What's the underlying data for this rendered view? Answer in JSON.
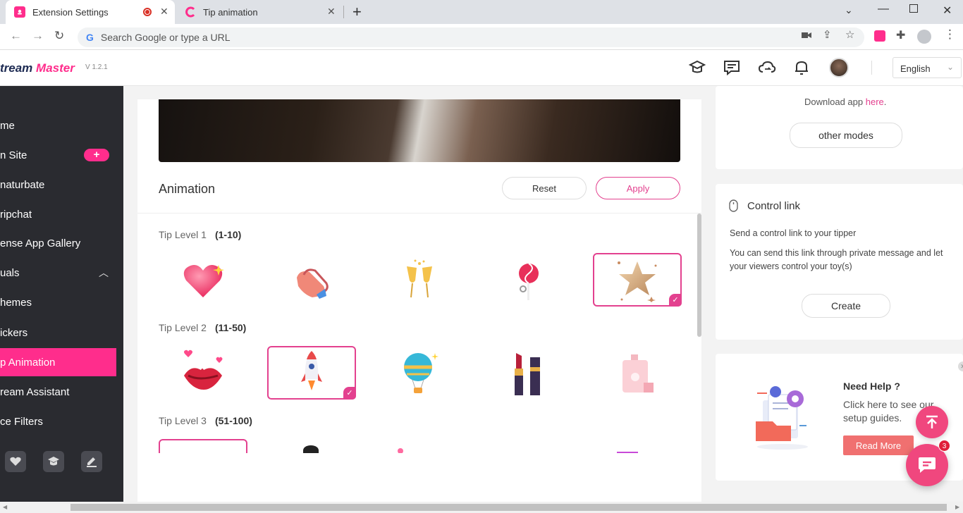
{
  "browser": {
    "tabs": [
      {
        "title": "Extension Settings",
        "active": true
      },
      {
        "title": "Tip animation",
        "active": false
      }
    ],
    "address_placeholder": "Search Google or type a URL"
  },
  "app": {
    "brand_prefix": "tream ",
    "brand_highlight": "Master",
    "version": "V 1.2.1",
    "language": "English"
  },
  "sidebar": {
    "items": [
      {
        "label": "me"
      },
      {
        "label": "n Site"
      },
      {
        "label": "naturbate"
      },
      {
        "label": "ripchat"
      },
      {
        "label": "ense App Gallery"
      },
      {
        "label": "uals"
      },
      {
        "label": "hemes"
      },
      {
        "label": "ickers"
      },
      {
        "label": "p Animation"
      },
      {
        "label": "ream Assistant"
      },
      {
        "label": "ce Filters"
      }
    ],
    "plus": "+"
  },
  "animation": {
    "title": "Animation",
    "reset_label": "Reset",
    "apply_label": "Apply",
    "levels": [
      {
        "label": "Tip Level 1",
        "range": "(1-10)"
      },
      {
        "label": "Tip Level 2",
        "range": "(11-50)"
      },
      {
        "label": "Tip Level 3",
        "range": "(51-100)"
      }
    ]
  },
  "right_panel": {
    "download_text": "Download app ",
    "download_link": "here",
    "download_period": ".",
    "other_modes": "other modes",
    "control_link_title": "Control link",
    "control_link_desc1": "Send a control link to your tipper",
    "control_link_desc2": "You can send this link through private message and let your viewers control your toy(s)",
    "create_label": "Create",
    "help_title": "Need Help ?",
    "help_text": "Click here to see our setup guides.",
    "read_more": "Read More",
    "chat_badge": "3"
  },
  "colors": {
    "accent": "#ff2d8c",
    "sidebar_bg": "#2a2b30",
    "apply_border": "#e3418f"
  }
}
